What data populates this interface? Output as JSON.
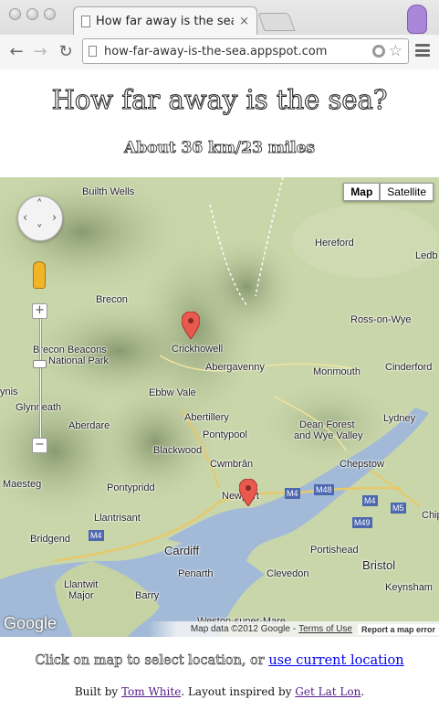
{
  "browser": {
    "tab_title": "How far away is the sea?",
    "tab_close": "×",
    "url": "how-far-away-is-the-sea.appspot.com"
  },
  "page": {
    "title": "How far away is the sea?",
    "distance": "About 36 km/23 miles"
  },
  "map": {
    "type_buttons": [
      "Map",
      "Satellite"
    ],
    "places": {
      "builth_wells": "Builth Wells",
      "hereford": "Hereford",
      "ledb": "Ledb",
      "brecon": "Brecon",
      "ross_on_wye": "Ross-on-Wye",
      "crickhowell": "Crickhowell",
      "brecon_beacons": "Brecon Beacons",
      "national_park": "National Park",
      "abergavenny": "Abergavenny",
      "monmouth": "Monmouth",
      "cinderford": "Cinderford",
      "ynis": "ynis",
      "glynneath": "Glynneath",
      "ebbw_vale": "Ebbw Vale",
      "lydney": "Lydney",
      "aberdare": "Aberdare",
      "abertillery": "Abertillery",
      "dean_forest": "Dean Forest",
      "and_wye_valley": "and Wye Valley",
      "pontypool": "Pontypool",
      "blackwood": "Blackwood",
      "cwmbran": "Cwmbrân",
      "chepstow": "Chepstow",
      "maesteg": "Maesteg",
      "pontypridd": "Pontypridd",
      "newport": "Newport",
      "llantrisant": "Llantrisant",
      "bridgend": "Bridgend",
      "cardiff": "Cardiff",
      "portishead": "Portishead",
      "bristol": "Bristol",
      "penarth": "Penarth",
      "clevedon": "Clevedon",
      "keynsham": "Keynsham",
      "llantwit": "Llantwit",
      "major": "Major",
      "barry": "Barry",
      "weston": "Weston-super-Mare",
      "chip": "Chip"
    },
    "roads": {
      "m4_a": "M4",
      "m48": "M48",
      "m4_b": "M4",
      "m5": "M5",
      "m49": "M49",
      "m4_c": "M4"
    },
    "logo": "Google",
    "attribution": "Map data ©2012 Google -",
    "terms": "Terms of Use",
    "report": "Report a map error",
    "zoom_in": "+",
    "zoom_out": "−"
  },
  "footer": {
    "click_text": "Click on map to select location, or ",
    "current_location_link": "use current location",
    "built_by": "Built by ",
    "author_link": "Tom White",
    "layout_text": ". Layout inspired by ",
    "inspired_link": "Get Lat Lon",
    "end": "."
  },
  "colors": {
    "land": "#c7d4a8",
    "hills": "#9fae84",
    "sea": "#9db6d6",
    "marker": "#e8594e",
    "link": "#0000ee"
  }
}
